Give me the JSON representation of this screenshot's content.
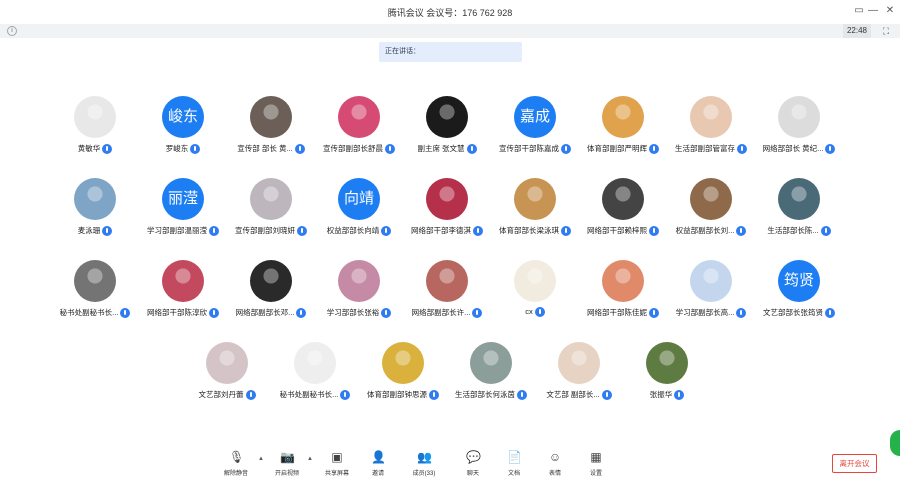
{
  "window": {
    "title": "腾讯会议 会议号：176 762 928",
    "controls": [
      "▭",
      "—",
      "□",
      "✕"
    ]
  },
  "strip": {
    "timer": "22:48"
  },
  "speaking_label": "正在讲话：",
  "participants": [
    {
      "name": "黄敏华",
      "avatar_text": "",
      "color": "#e8e8e8"
    },
    {
      "name": "罗峻东",
      "avatar_text": "峻东",
      "color": "#1d7ef3",
      "host": true
    },
    {
      "name": "宣传部 部长 黄...",
      "avatar_text": "",
      "color": "#6b5f57"
    },
    {
      "name": "宣传部副部长舒晨",
      "avatar_text": "",
      "color": "#d64b74"
    },
    {
      "name": "副主席 张文慧",
      "avatar_text": "",
      "color": "#1b1b1b"
    },
    {
      "name": "宣传部干部陈嘉成",
      "avatar_text": "嘉成",
      "color": "#1d7ef3"
    },
    {
      "name": "体育部副部严明辉",
      "avatar_text": "",
      "color": "#e0a24c"
    },
    {
      "name": "生活部副部管富存",
      "avatar_text": "",
      "color": "#e9c8b2"
    },
    {
      "name": "网络部部长 黄纪...",
      "avatar_text": "",
      "color": "#dcdcdc"
    },
    {
      "name": "麦泳珊",
      "avatar_text": "",
      "color": "#7fa5c6"
    },
    {
      "name": "学习部副部温丽滢",
      "avatar_text": "丽滢",
      "color": "#1d7ef3"
    },
    {
      "name": "宣传部副部刘晓妍",
      "avatar_text": "",
      "color": "#bdb7bd"
    },
    {
      "name": "权益部部长向靖",
      "avatar_text": "向靖",
      "color": "#1d7ef3"
    },
    {
      "name": "网络部干部李德淇",
      "avatar_text": "",
      "color": "#b5304a"
    },
    {
      "name": "体育部部长梁泳琪",
      "avatar_text": "",
      "color": "#c79454"
    },
    {
      "name": "网络部干部赖梓熙",
      "avatar_text": "",
      "color": "#444"
    },
    {
      "name": "权益部副部长刘...",
      "avatar_text": "",
      "color": "#8f6a4a"
    },
    {
      "name": "生活部部长陈...",
      "avatar_text": "",
      "color": "#4a6a78"
    },
    {
      "name": "秘书处副秘书长...",
      "avatar_text": "",
      "color": "#747474"
    },
    {
      "name": "网络部干部陈淳欣",
      "avatar_text": "",
      "color": "#c34a5e"
    },
    {
      "name": "网络部副部长邓...",
      "avatar_text": "",
      "color": "#2a2a2a"
    },
    {
      "name": "学习部部长张裕",
      "avatar_text": "",
      "color": "#c58aa5"
    },
    {
      "name": "网络部副部长许...",
      "avatar_text": "",
      "color": "#b7675f"
    },
    {
      "name": "cx",
      "avatar_text": "",
      "color": "#f2ece0"
    },
    {
      "name": "网络部干部陈佳妮",
      "avatar_text": "",
      "color": "#e08a6a"
    },
    {
      "name": "学习部副部长高...",
      "avatar_text": "",
      "color": "#c4d6ee"
    },
    {
      "name": "文艺部部长张筠贤",
      "avatar_text": "筠贤",
      "color": "#1d7ef3"
    },
    {
      "name": "文艺部刘丹蕾",
      "avatar_text": "",
      "color": "#d4c4c8"
    },
    {
      "name": "秘书处副秘书长...",
      "avatar_text": "",
      "color": "#eeeeee"
    },
    {
      "name": "体育部副部钟思源",
      "avatar_text": "",
      "color": "#d9b13c"
    },
    {
      "name": "生活部部长何泳茵",
      "avatar_text": "",
      "color": "#8c9e9a"
    },
    {
      "name": "文艺部 副部长...",
      "avatar_text": "",
      "color": "#e6d3c3"
    },
    {
      "name": "张振华",
      "avatar_text": "",
      "color": "#5e7b42"
    }
  ],
  "toolbar": [
    {
      "label": "解除静音",
      "icon": "mic-muted-icon",
      "glyph": "🎙"
    },
    {
      "label": "开启视频",
      "icon": "camera-off-icon",
      "glyph": "📷"
    },
    {
      "label": "共享屏幕",
      "icon": "share-screen-icon",
      "glyph": "▣"
    },
    {
      "label": "邀请",
      "icon": "invite-icon",
      "glyph": "👤"
    },
    {
      "label": "成员(33)",
      "icon": "members-icon",
      "glyph": "👥"
    },
    {
      "label": "聊天",
      "icon": "chat-icon",
      "glyph": "💬"
    },
    {
      "label": "文档",
      "icon": "document-icon",
      "glyph": "📄"
    },
    {
      "label": "表情",
      "icon": "emoji-icon",
      "glyph": "☺"
    },
    {
      "label": "设置",
      "icon": "settings-icon",
      "glyph": "▦"
    }
  ],
  "leave_button": "离开会议"
}
